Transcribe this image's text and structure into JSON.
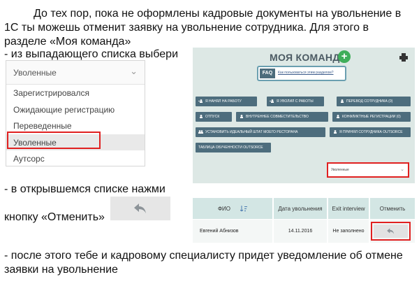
{
  "instructions": {
    "line1": "До тех пор, пока не оформлены кадровые документы на увольнение в",
    "line2": "1С ты можешь отменит заявку на увольнение сотрудника. Для этого в",
    "line3": "разделе «Моя команда»",
    "line4": "- из выпадающего списка выбери",
    "line5": "- в открывшемся списке нажми",
    "line6": "кнопку «Отменить»",
    "line7": "- после этого тебе и кадровому специалисту придет уведомление об отмене",
    "line8": "заявки на увольнение"
  },
  "dropdown": {
    "selected": "Уволенные",
    "options": [
      "Зарегистрировался",
      "Ожидающие регистрацию",
      "Переведенные",
      "Уволенные",
      "Аутсорс"
    ]
  },
  "team_panel": {
    "title": "МОЯ КОМАНДА",
    "plus_label": "+",
    "faq_tag": "FAQ",
    "faq_link": "Как пользоваться этим разделом?",
    "buttons": [
      "Я НАНЯЛ НА РАБОТУ",
      "Я УВОЛИЛ С РАБОТЫ",
      "ПЕРЕВОД СОТРУДНИКА (0)",
      "ОТПУСК",
      "ВНУТРЕННЕЕ СОВМЕСТИТЕЛЬСТВО",
      "КОНФЛИКТНЫЕ РЕГИСТРАЦИИ (0)",
      "УСТАНОВИТЬ ИДЕАЛЬНЫЙ ШТАТ МОЕГО РЕСТОРАНА",
      "Я ПРИНЯЛ СОТРУДНИКА OUTSORCE",
      "ТАБЛИЦА ОБУЧЕННОСТИ OUTSORCE"
    ],
    "filter_value": "Уволенные"
  },
  "table": {
    "headers": [
      "ФИО",
      "Дата увольнения",
      "Exit interview",
      "Отменить"
    ],
    "row": {
      "name": "Евгений Абнизов",
      "date": "14.11.2016",
      "exit_interview": "Не заполнено"
    }
  },
  "colors": {
    "highlight": "#e02020",
    "button": "#4d6d7d",
    "panel_bg": "#dde8e5",
    "add": "#3fae5a"
  }
}
